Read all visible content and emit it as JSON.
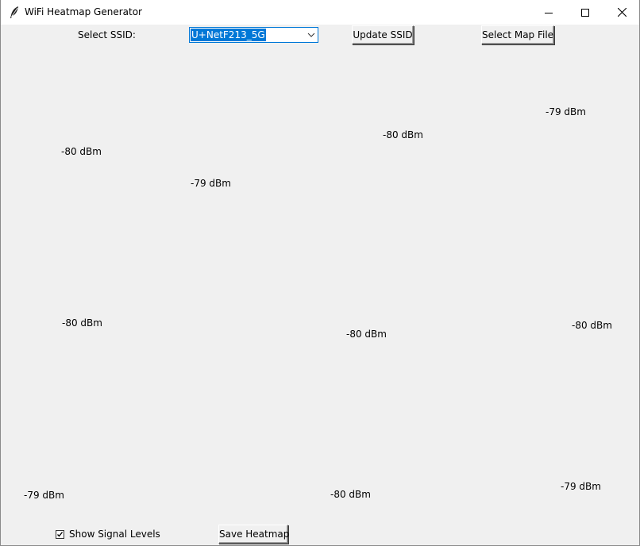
{
  "window": {
    "title": "WiFi Heatmap Generator",
    "controls": {
      "minimize_icon": "minimize-icon",
      "maximize_icon": "maximize-icon",
      "close_icon": "close-icon"
    }
  },
  "toolbar": {
    "ssid_label": "Select SSID:",
    "ssid_selected": "U+NetF213_5G",
    "update_ssid_label": "Update SSID",
    "select_map_label": "Select Map File"
  },
  "signals": [
    "-79 dBm",
    "-80 dBm",
    "-80 dBm",
    "-79 dBm",
    "-80 dBm",
    "-80 dBm",
    "-80 dBm",
    "-79 dBm",
    "-80 dBm",
    "-79 dBm"
  ],
  "footer": {
    "show_levels_label": "Show Signal Levels",
    "show_levels_checked": true,
    "save_label": "Save Heatmap"
  },
  "colors": {
    "background": "#f0f0f0",
    "selection": "#0078d7"
  }
}
